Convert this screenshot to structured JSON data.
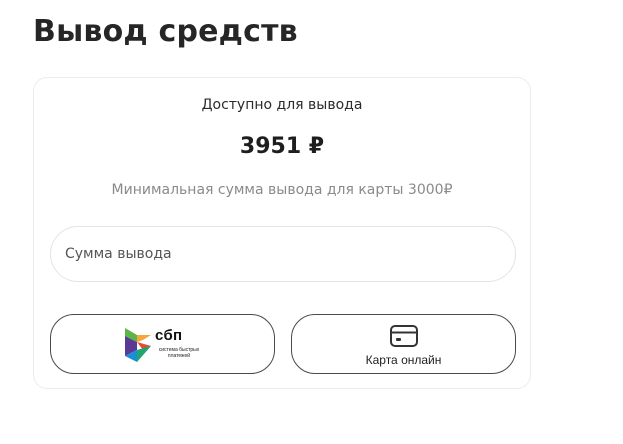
{
  "page": {
    "title": "Вывод средств"
  },
  "withdrawal": {
    "available_label": "Доступно для вывода",
    "balance": "3951 ₽",
    "min_note": "Минимальная сумма вывода для карты 3000₽",
    "amount_placeholder": "Сумма вывода"
  },
  "methods": {
    "sbp": {
      "logo_text": "сбп",
      "logo_subtitle": "система быстрых платежей"
    },
    "card": {
      "label": "Карта онлайн",
      "icon": "credit-card-icon"
    }
  },
  "colors": {
    "sbp_green": "#5bb646",
    "sbp_orange": "#f4a73a",
    "sbp_red": "#e54a3c",
    "sbp_purple": "#5b3a95",
    "sbp_blue": "#1a8fd6",
    "sbp_teal": "#1fa56e"
  }
}
